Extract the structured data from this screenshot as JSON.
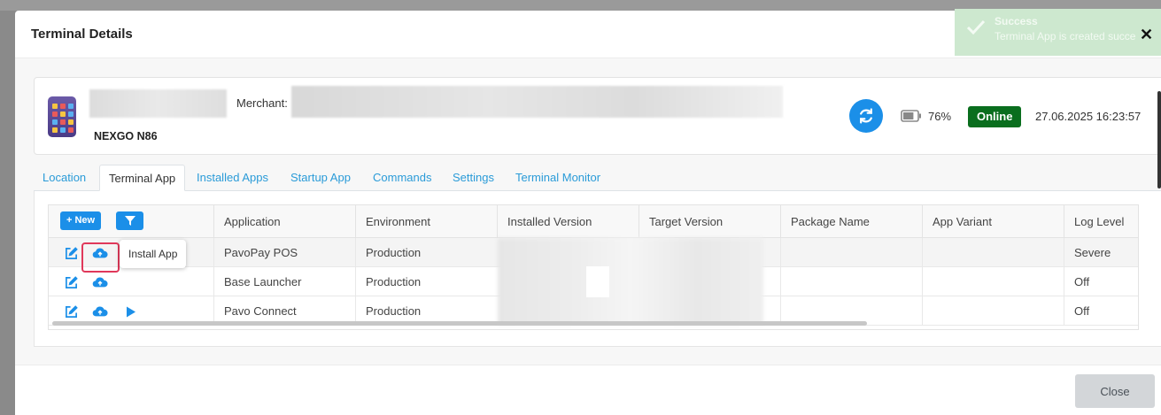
{
  "modal": {
    "title": "Terminal Details",
    "close_label": "Close"
  },
  "terminal": {
    "model": "NEXGO N86",
    "merchant_label": "Merchant:",
    "battery": "76%",
    "battery_level": 0.76,
    "status": "Online",
    "datetime": "27.06.2025 16:23:57"
  },
  "tabs": [
    {
      "label": "Location"
    },
    {
      "label": "Terminal App"
    },
    {
      "label": "Installed Apps"
    },
    {
      "label": "Startup App"
    },
    {
      "label": "Commands"
    },
    {
      "label": "Settings"
    },
    {
      "label": "Terminal Monitor"
    }
  ],
  "active_tab": "Terminal App",
  "toolbar": {
    "new_label": "+ New"
  },
  "table": {
    "columns": [
      "Application",
      "Environment",
      "Installed Version",
      "Target Version",
      "Package Name",
      "App Variant",
      "Log Level"
    ],
    "rows": [
      {
        "application": "PavoPay POS",
        "environment": "Production",
        "log_level": "Severe"
      },
      {
        "application": "Base Launcher",
        "environment": "Production",
        "log_level": "Off"
      },
      {
        "application": "Pavo Connect",
        "environment": "Production",
        "log_level": "Off"
      }
    ]
  },
  "tooltip": "Install App",
  "toast": {
    "title": "Success",
    "message": "Terminal App is created succe"
  },
  "colors": {
    "accent": "#1b8fe8",
    "online": "#0a6e1e",
    "highlight": "#e0385a"
  },
  "icons": [
    "device-icon",
    "sync-icon",
    "battery-icon",
    "filter-icon",
    "edit-icon",
    "cloud-upload-icon",
    "play-icon",
    "check-icon",
    "close-icon"
  ]
}
